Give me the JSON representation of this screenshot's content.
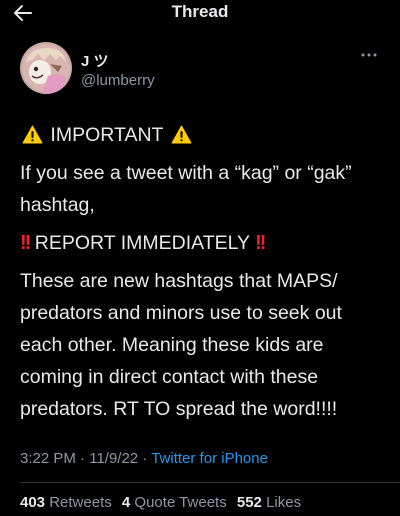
{
  "header": {
    "title": "Thread",
    "back_icon": "arrow-left-icon"
  },
  "author": {
    "display_name": "J ツ",
    "handle": "@lumberry",
    "more_icon": "ellipsis-icon"
  },
  "tweet": {
    "line1_text": "IMPORTANT",
    "line2_text": "If you see a tweet with a “kag” or “gak” hashtag,",
    "line3_text": "REPORT IMMEDIATELY",
    "line4_text": "These are new hashtags that MAPS/ predators and minors use to seek out each other. Meaning these kids are coming in direct contact with these predators. RT TO spread the word!!!!",
    "warning_icon": "warning-emoji-icon",
    "alert_icon": "double-exclamation-emoji-icon"
  },
  "meta": {
    "time": "3:22 PM",
    "separator1": " · ",
    "date": "11/9/22",
    "separator2": " · ",
    "source": "Twitter for iPhone"
  },
  "stats": {
    "retweets_count": "403",
    "retweets_label": "Retweets",
    "quotes_count": "4",
    "quotes_label": "Quote Tweets",
    "likes_count": "552",
    "likes_label": "Likes"
  },
  "colors": {
    "background": "#000000",
    "text": "#e7e9ea",
    "secondary": "#8b98a5",
    "link": "#1d9bf0",
    "divider": "#2f3336",
    "alert_red": "#f4212e",
    "warning_yellow": "#ffcc00"
  }
}
